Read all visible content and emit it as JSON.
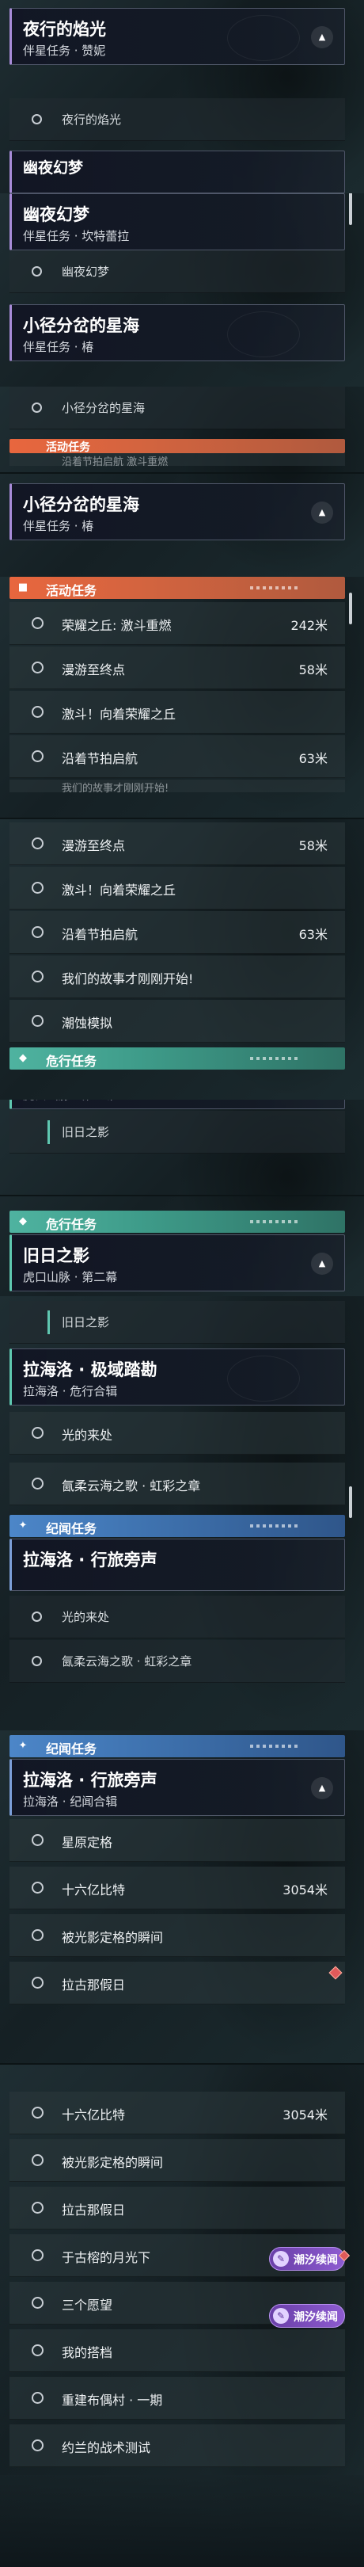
{
  "companion_quests": {
    "section_label": "伴星任务",
    "yexing": {
      "title": "夜行的焰光",
      "subtitle": "伴星任务 · 赞妮",
      "step": "夜行的焰光"
    },
    "youye": {
      "title": "幽夜幻梦",
      "subtitle": "伴星任务 · 坎特蕾拉",
      "step": "幽夜幻梦"
    },
    "xiaojing": {
      "title": "小径分岔的星海",
      "subtitle": "伴星任务 · 椿",
      "step": "小径分岔的星海"
    }
  },
  "activity_quests": {
    "section_label": "活动任务",
    "steps": [
      {
        "label": "荣耀之丘: 激斗重燃",
        "distance": "242米"
      },
      {
        "label": "漫游至终点",
        "distance": "58米"
      },
      {
        "label": "激斗！向着荣耀之丘",
        "distance": ""
      },
      {
        "label": "沿着节拍启航",
        "distance": "63米"
      },
      {
        "label": "我们的故事才刚刚开始!",
        "distance": ""
      },
      {
        "label": "潮蚀模拟",
        "distance": ""
      }
    ],
    "peek_label": "沿着节拍启航 激斗重燃"
  },
  "danger_quests": {
    "section_label": "危行任务",
    "jiuri": {
      "title": "旧日之影",
      "subtitle": "虎口山脉 · 第二幕",
      "step": "旧日之影"
    }
  },
  "lahailuo": {
    "title": "拉海洛 · 极域踏勘",
    "subtitle": "拉海洛 · 危行合辑",
    "steps": [
      "光的来处",
      "氤柔云海之歌 · 虹彩之章"
    ]
  },
  "chronicle_quests": {
    "section_label": "纪闻任务",
    "card": {
      "title": "拉海洛 · 行旅旁声",
      "subtitle": "拉海洛 · 纪闻合辑"
    },
    "steps": [
      {
        "label": "星原定格",
        "distance": ""
      },
      {
        "label": "十六亿比特",
        "distance": "3054米"
      },
      {
        "label": "被光影定格的瞬间",
        "distance": ""
      },
      {
        "label": "拉古那假日",
        "distance": ""
      },
      {
        "label": "于古榕的月光下",
        "distance": ""
      },
      {
        "label": "三个愿望",
        "distance": ""
      },
      {
        "label": "我的搭档",
        "distance": ""
      },
      {
        "label": "重建布偶村 · 一期",
        "distance": ""
      },
      {
        "label": "约兰的战术测试",
        "distance": ""
      }
    ]
  },
  "badge": {
    "label": "潮汐续闻",
    "icon": "quill-icon"
  },
  "icons": {
    "step": "circle-icon",
    "collapse": "chevron-up-icon",
    "active_step": "bar-indicator-icon"
  },
  "colors": {
    "activity": "#e8663e",
    "danger": "#4fb3a0",
    "chronicle": "#4c86c8",
    "companion": "#a88bd8",
    "badge": "#8d5bd0"
  }
}
